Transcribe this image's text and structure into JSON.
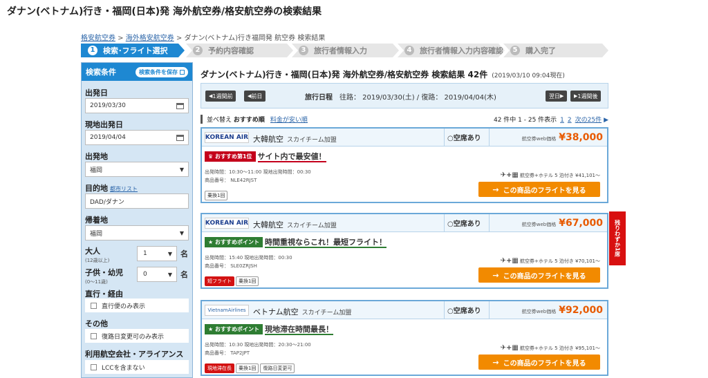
{
  "page": {
    "title": "ダナン(ベトナム)行き・福岡(日本)発 海外航空券/格安航空券の検索結果"
  },
  "breadcrumb": {
    "item1": "格安航空券",
    "sep1": " > ",
    "item2": "海外格安航空券",
    "sep2": " > ",
    "current": "ダナン(ベトナム)行き福岡発 航空券 検索結果"
  },
  "steps": [
    {
      "num": "1",
      "label": "検索･フライト選択"
    },
    {
      "num": "2",
      "label": "予約内容確認"
    },
    {
      "num": "3",
      "label": "旅行者情報入力"
    },
    {
      "num": "4",
      "label": "旅行者情報入力内容確認"
    },
    {
      "num": "5",
      "label": "購入完了"
    }
  ],
  "sidebar": {
    "title": "検索条件",
    "save_label": "検索条件を保存",
    "dep_date_label": "出発日",
    "dep_date": "2019/03/30",
    "local_dep_label": "現地出発日",
    "local_dep_date": "2019/04/04",
    "origin_label": "出発地",
    "origin": "福岡",
    "dest_label": "目的地",
    "dest_link": "都市リスト",
    "dest": "DAD/ダナン",
    "return_label": "帰着地",
    "return": "福岡",
    "adult_label": "大人",
    "adult_sub": "(12歳以上)",
    "adult_val": "1",
    "child_label": "子供・幼児",
    "child_sub": "(0〜11歳)",
    "child_val": "0",
    "unit": "名",
    "direct_label": "直行・経由",
    "direct_opt": "直行便のみ表示",
    "other_label": "その他",
    "other_opt": "復路日変更可のみ表示",
    "airline_label": "利用航空会社・アライアンス",
    "airline_opt": "LCCを含まない"
  },
  "results": {
    "title": "ダナン(ベトナム)行き・福岡(日本)発 海外航空券/格安航空券 検索結果 42件",
    "timestamp": "(2019/03/10 09:04現在)",
    "prev_week": "1週間前",
    "prev_day": "前日",
    "next_day": "翌日",
    "next_week": "1週間後",
    "itinerary_label": "旅行日程",
    "itinerary": "往路： 2019/03/30(土) / 復路： 2019/04/04(木)",
    "sort_label": "並べ替え",
    "sort_current": "おすすめ順",
    "sort_alt": "料金が安い順",
    "count": "42 件中 1 - 25 件表示",
    "page1": "1",
    "page2": "2",
    "next25": "次の25件"
  },
  "cards": [
    {
      "logo": "KOREAN AIR",
      "airline": "大韓航空",
      "alliance": "スカイチーム加盟",
      "seat": "○空席あり",
      "price_label": "航空券web価格",
      "price": "¥38,000",
      "badge": "おすすめ第1位",
      "msg": "サイト内で最安値！",
      "times": "出発時間：10:30〜11:00  現地出発時間：00:30",
      "code": "商品番号： NLE42RJST",
      "tags": [
        "乗換1回"
      ],
      "hotel_label": "航空券+ホテル 5 泊付き",
      "hotel_price": "¥41,101〜",
      "cta": "この商品のフライトを見る"
    },
    {
      "logo": "KOREAN AIR",
      "airline": "大韓航空",
      "alliance": "スカイチーム加盟",
      "seat": "○空席あり",
      "price_label": "航空券web価格",
      "price": "¥67,000",
      "badge": "おすすめポイント",
      "msg": "時間重視ならこれ！最短フライト！",
      "times": "出発時間：15:40  現地出発時間：00:30",
      "code": "商品番号： SLE0ZRJSH",
      "tags": [
        "短フライト",
        "乗換1回"
      ],
      "hotel_label": "航空券+ホテル 5 泊付き",
      "hotel_price": "¥70,101〜",
      "cta": "この商品のフライトを見る",
      "ribbon": "残りわずか1席"
    },
    {
      "logo": "VietnamAirlines",
      "airline": "ベトナム航空",
      "alliance": "スカイチーム加盟",
      "seat": "○空席あり",
      "price_label": "航空券web価格",
      "price": "¥92,000",
      "badge": "おすすめポイント",
      "msg": "現地滞在時間最長！",
      "times": "出発時間：10:30  現地出発時間：20:30〜21:00",
      "code": "商品番号： TAP2JPT",
      "tags": [
        "現地滞在長",
        "乗換1回",
        "復路日変更可"
      ],
      "hotel_label": "航空券+ホテル 5 泊付き",
      "hotel_price": "¥95,101〜",
      "cta": "この商品のフライトを見る"
    }
  ]
}
